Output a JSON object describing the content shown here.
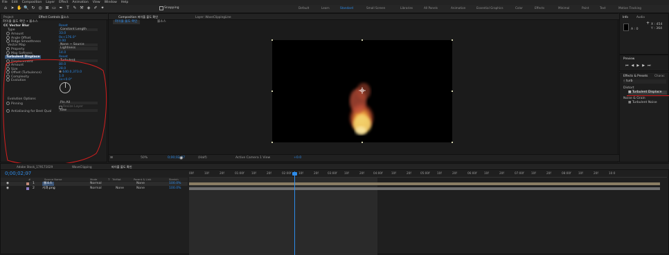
{
  "menu": [
    "File",
    "Edit",
    "Composition",
    "Layer",
    "Effect",
    "Animation",
    "View",
    "Window",
    "Help"
  ],
  "toolbar": {
    "snapping_label": "Snapping",
    "workspaces": [
      "Default",
      "Learn",
      "Standard",
      "Small Screen",
      "Libraries",
      "All Panels",
      "Animation",
      "Essential Graphics",
      "Color",
      "Effects",
      "Minimal",
      "Paint",
      "Text",
      "Motion Tracking"
    ],
    "active_workspace": "Standard"
  },
  "project_tab": "Project",
  "effect_controls": {
    "tab": "Effect Controls 불소스",
    "breadcrumb": "파이풀 불도 확인 • 불소스",
    "fx1": {
      "name": "CC Vector Blur",
      "reset": "Reset"
    },
    "rows1": [
      {
        "label": "Type",
        "select": "Constant Length"
      },
      {
        "label": "Amount",
        "value": "33.0"
      },
      {
        "label": "Angle Offset",
        "value": "0x+176.0°"
      },
      {
        "label": "Ridge Smoothness",
        "value": "0.00"
      },
      {
        "label": "Vector Map",
        "select": "None  ~  Source"
      },
      {
        "label": "Property",
        "select": "Lightness"
      },
      {
        "label": "Map Softness",
        "value": "14.0"
      }
    ],
    "fx2": {
      "name": "Turbulent Displace",
      "reset": "Reset"
    },
    "rows2": [
      {
        "label": "Displacement",
        "select": "Turbulent"
      },
      {
        "label": "Amount",
        "value": "80.0"
      },
      {
        "label": "Size",
        "value": "28.0"
      },
      {
        "label": "Offset (Turbulence)",
        "value": "640.0,373.0"
      },
      {
        "label": "Complexity",
        "value": "1.0"
      },
      {
        "label": "Evolution",
        "value": "1x+0.0°"
      }
    ],
    "rows3": [
      {
        "label": "Evolution Options",
        "value": ""
      },
      {
        "label": "Pinning",
        "select": "Pin All"
      },
      {
        "label": "",
        "value": "Resize Layer"
      },
      {
        "label": "Antialiasing for Best Qual",
        "select": "Low"
      }
    ]
  },
  "composition": {
    "tab": "Composition 파이풀 불도 확인",
    "layer_tab": "Layer: WaveClippingLine",
    "subtab": "파이풀 불도 확인",
    "subtab2": "불소스",
    "zoom": "50%",
    "timecode": "0;00;02;07",
    "resolution": "(Half)",
    "camera": "Active Camera",
    "view": "1 View",
    "exposure": "+0.0"
  },
  "info": {
    "tab1": "Info",
    "tab2": "Audio",
    "x": "X : 454",
    "y": "Y : 364",
    "a": "A : 0"
  },
  "preview": {
    "tab": "Preview"
  },
  "effects_presets": {
    "tab": "Effects & Presets",
    "tab2": "Charac",
    "search": "turb",
    "group1": "Distort",
    "item1": "Turbulent Displace",
    "group2": "Noise & Grain",
    "item2": "Turbulent Noise"
  },
  "timeline": {
    "tabs": [
      "Adobe Stock_179171029",
      "WaveClipping",
      "파이풀 불도 확인"
    ],
    "timecode": "0;00;02;07",
    "columns": [
      "#",
      "Source Name",
      "Mode",
      "T",
      "TrkMat",
      "Parent & Link",
      "Stretch"
    ],
    "layers": [
      {
        "num": "1",
        "name": "불소스",
        "mode": "Normal",
        "trkmat": "",
        "parent": "None",
        "stretch": "100.0%"
      },
      {
        "num": "2",
        "name": "사과.png",
        "mode": "Normal",
        "trkmat": "None",
        "parent": "None",
        "stretch": "100.0%"
      }
    ],
    "ruler": [
      "00f",
      "10f",
      "20f",
      "01:00f",
      "10f",
      "20f",
      "02:00f",
      "10f",
      "20f",
      "03:00f",
      "10f",
      "20f",
      "04:00f",
      "10f",
      "20f",
      "05:00f",
      "10f",
      "20f",
      "06:00f",
      "10f",
      "20f",
      "07:00f",
      "10f",
      "20f",
      "08:00f",
      "10f",
      "20f",
      "10:0"
    ]
  }
}
